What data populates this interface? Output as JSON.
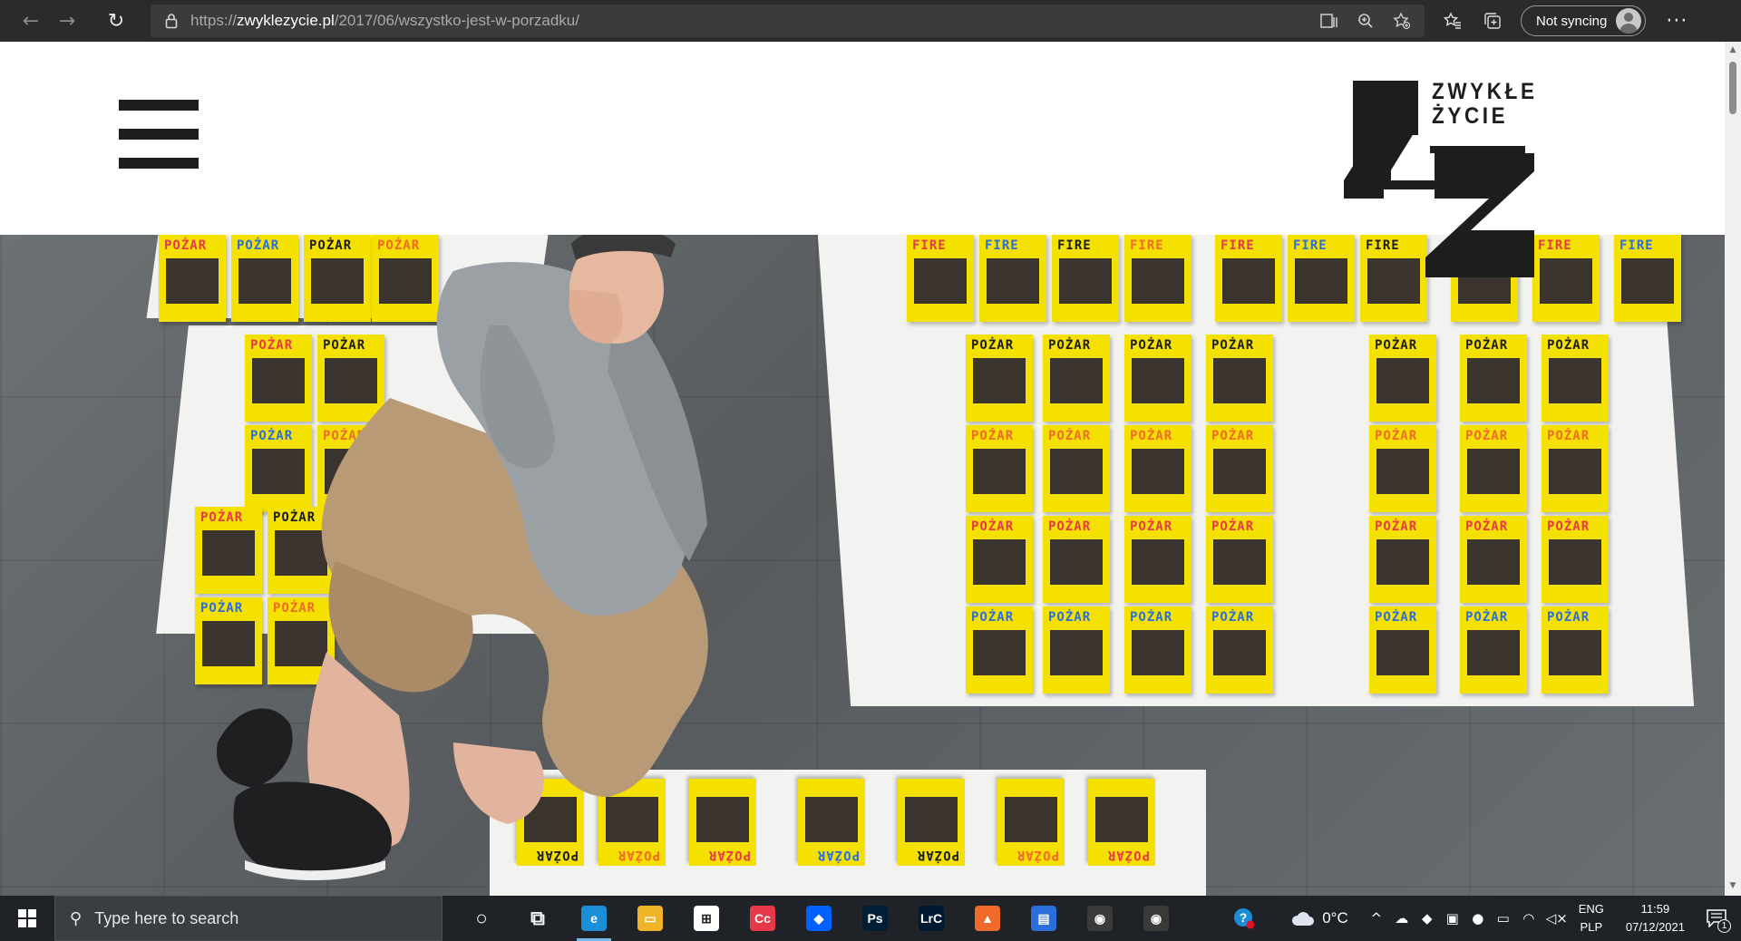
{
  "browser": {
    "url_scheme": "https://",
    "url_host": "zwyklezycie.pl",
    "url_path": "/2017/06/wszystko-jest-w-porzadku/",
    "sync_label": "Not syncing",
    "more_label": "···"
  },
  "site": {
    "logo_line1": "ZWYKŁE",
    "logo_line2": "ŻYCIE",
    "book_words": [
      "POŻAR",
      "FIRE"
    ],
    "colors": {
      "book_yellow": "#f5e100",
      "logo_black": "#1d1d1b"
    }
  },
  "taskbar": {
    "search_placeholder": "Type here to search",
    "weather_temp": "0°C",
    "lang_1": "ENG",
    "lang_2": "PLP",
    "time": "11:59",
    "date": "07/12/2021",
    "notification_count": "1",
    "apps": [
      {
        "name": "cortana",
        "label": "○",
        "color": "transparent"
      },
      {
        "name": "task-view",
        "label": "⧉",
        "color": "transparent"
      },
      {
        "name": "edge",
        "label": "e",
        "color": "#1a8fd8"
      },
      {
        "name": "file-explorer",
        "label": "▭",
        "color": "#f0b429"
      },
      {
        "name": "store",
        "label": "⊞",
        "color": "#ffffff"
      },
      {
        "name": "creative-cloud",
        "label": "Cc",
        "color": "#e8394b"
      },
      {
        "name": "dropbox",
        "label": "◆",
        "color": "#0061fe"
      },
      {
        "name": "photoshop",
        "label": "Ps",
        "color": "#001e36"
      },
      {
        "name": "lightroom-classic",
        "label": "LrC",
        "color": "#001a33"
      },
      {
        "name": "affinity",
        "label": "▲",
        "color": "#f06a2a"
      },
      {
        "name": "notes",
        "label": "▤",
        "color": "#2a6fdb"
      },
      {
        "name": "davinci-resolve",
        "label": "◉",
        "color": "#3a3a3a"
      },
      {
        "name": "davinci-panels",
        "label": "◉",
        "color": "#3a3a3a"
      }
    ]
  }
}
